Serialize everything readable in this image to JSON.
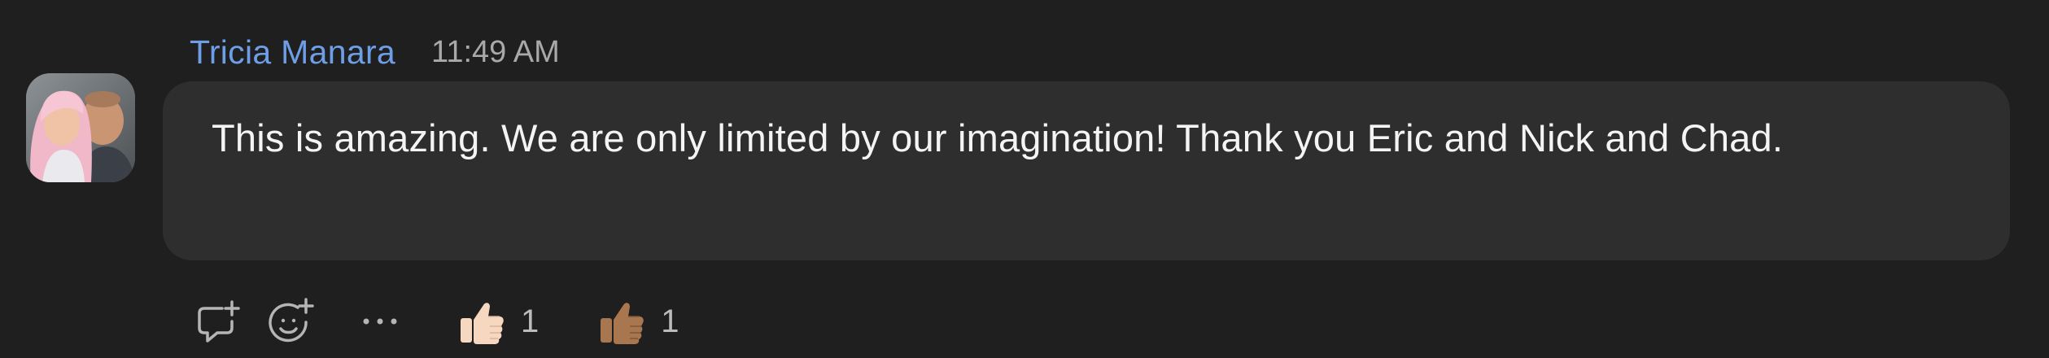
{
  "message": {
    "sender": "Tricia Manara",
    "time": "11:49 AM",
    "text": "This is amazing. We are only limited by our imagination! Thank you Eric and Nick and Chad."
  },
  "actions": {
    "reply_icon": "reply-thread-icon",
    "add_reaction_icon": "add-reaction-icon",
    "more_icon": "more-options-icon"
  },
  "reactions": [
    {
      "emoji": "thumbs-up-light",
      "count": "1"
    },
    {
      "emoji": "thumbs-up-medium-dark",
      "count": "1"
    }
  ],
  "colors": {
    "background": "#1f1f1f",
    "bubble": "#2e2e2e",
    "sender_name": "#6e9fe6",
    "timestamp": "#a9a9a9"
  }
}
